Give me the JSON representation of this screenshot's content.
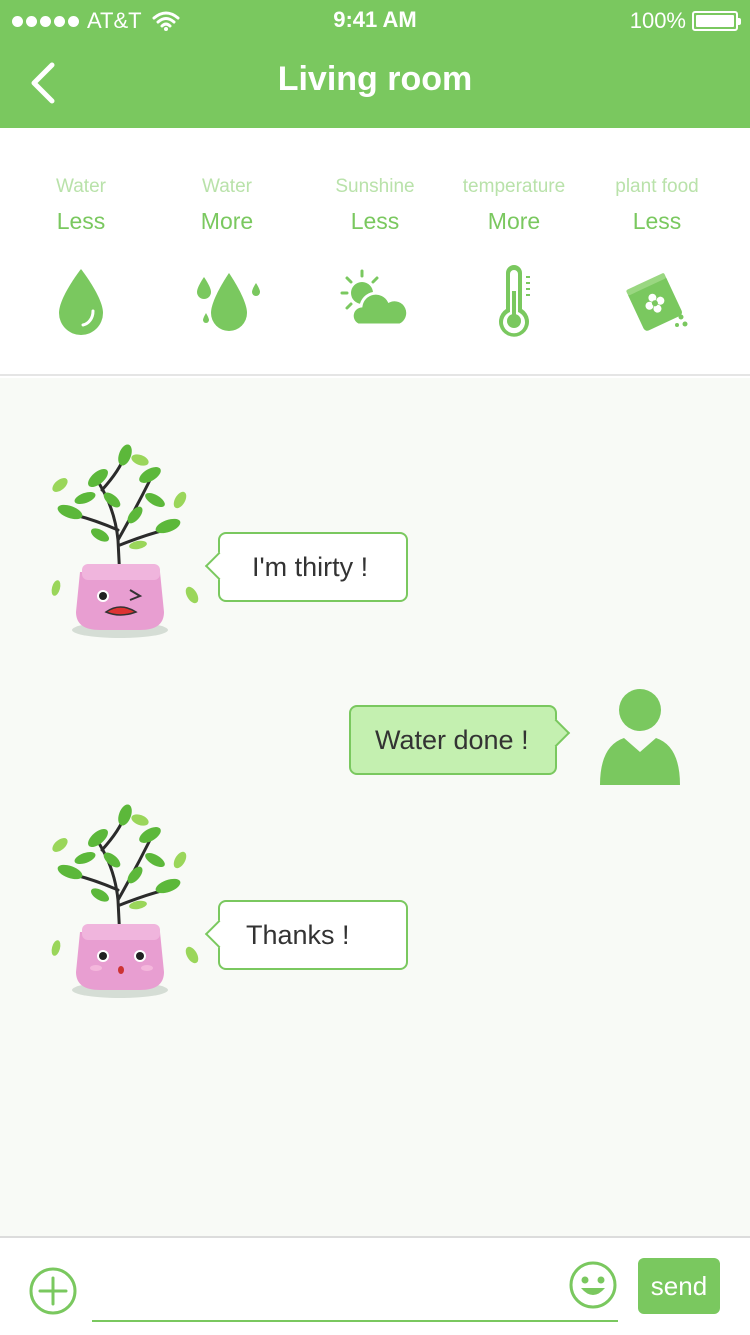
{
  "status_bar": {
    "carrier": "AT&T",
    "time": "9:41 AM",
    "battery": "100%"
  },
  "nav": {
    "title": "Living room",
    "back_icon": "chevron-left-icon"
  },
  "indicators": [
    {
      "label": "Water",
      "value": "Less",
      "icon": "water-drop-icon"
    },
    {
      "label": "Water",
      "value": "More",
      "icon": "water-drops-icon"
    },
    {
      "label": "Sunshine",
      "value": "Less",
      "icon": "sun-cloud-icon"
    },
    {
      "label": "temperature",
      "value": "More",
      "icon": "thermometer-icon"
    },
    {
      "label": "plant food",
      "value": "Less",
      "icon": "fertilizer-icon"
    }
  ],
  "messages": [
    {
      "sender": "plant",
      "mood": "sad",
      "text": "I'm thirty !"
    },
    {
      "sender": "user",
      "text": "Water done !"
    },
    {
      "sender": "plant",
      "mood": "happy",
      "text": "Thanks !"
    }
  ],
  "input": {
    "value": "",
    "placeholder": "",
    "send_label": "send"
  },
  "colors": {
    "accent": "#7ac85f",
    "light_accent": "#b9e2aa",
    "bubble_user": "#c4f0b0",
    "chat_bg": "#f8faf6",
    "pot": "#e89ed1"
  }
}
